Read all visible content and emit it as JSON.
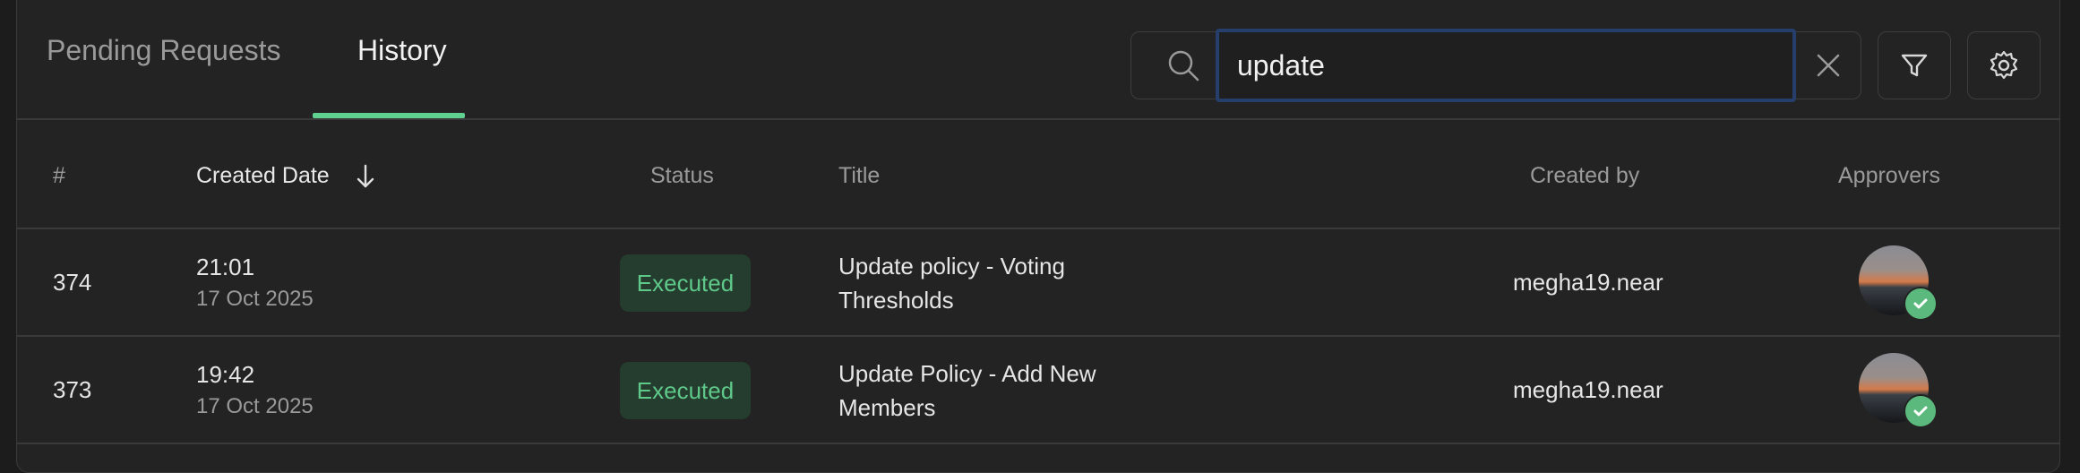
{
  "tabs": [
    {
      "label": "Pending Requests",
      "active": false
    },
    {
      "label": "History",
      "active": true
    }
  ],
  "search": {
    "value": "update",
    "placeholder": ""
  },
  "icons": {
    "search": "search-icon",
    "clear": "close-icon",
    "filter": "filter-icon",
    "settings": "gear-icon",
    "sort": "arrow-down-icon",
    "approved": "checkmark-icon"
  },
  "colors": {
    "accent": "#5fd08f",
    "status_executed_bg": "#243d2f",
    "status_executed_text": "#5fc98a",
    "focus_ring": "#263e6b"
  },
  "columns": {
    "id": "#",
    "created_date": "Created Date",
    "status": "Status",
    "title": "Title",
    "created_by": "Created by",
    "approvers": "Approvers"
  },
  "rows": [
    {
      "id": "374",
      "time": "21:01",
      "date": "17 Oct 2025",
      "status": "Executed",
      "title_line1": "Update policy - Voting",
      "title_line2": "Thresholds",
      "created_by": "megha19.near"
    },
    {
      "id": "373",
      "time": "19:42",
      "date": "17 Oct 2025",
      "status": "Executed",
      "title_line1": "Update Policy - Add New",
      "title_line2": "Members",
      "created_by": "megha19.near"
    }
  ]
}
